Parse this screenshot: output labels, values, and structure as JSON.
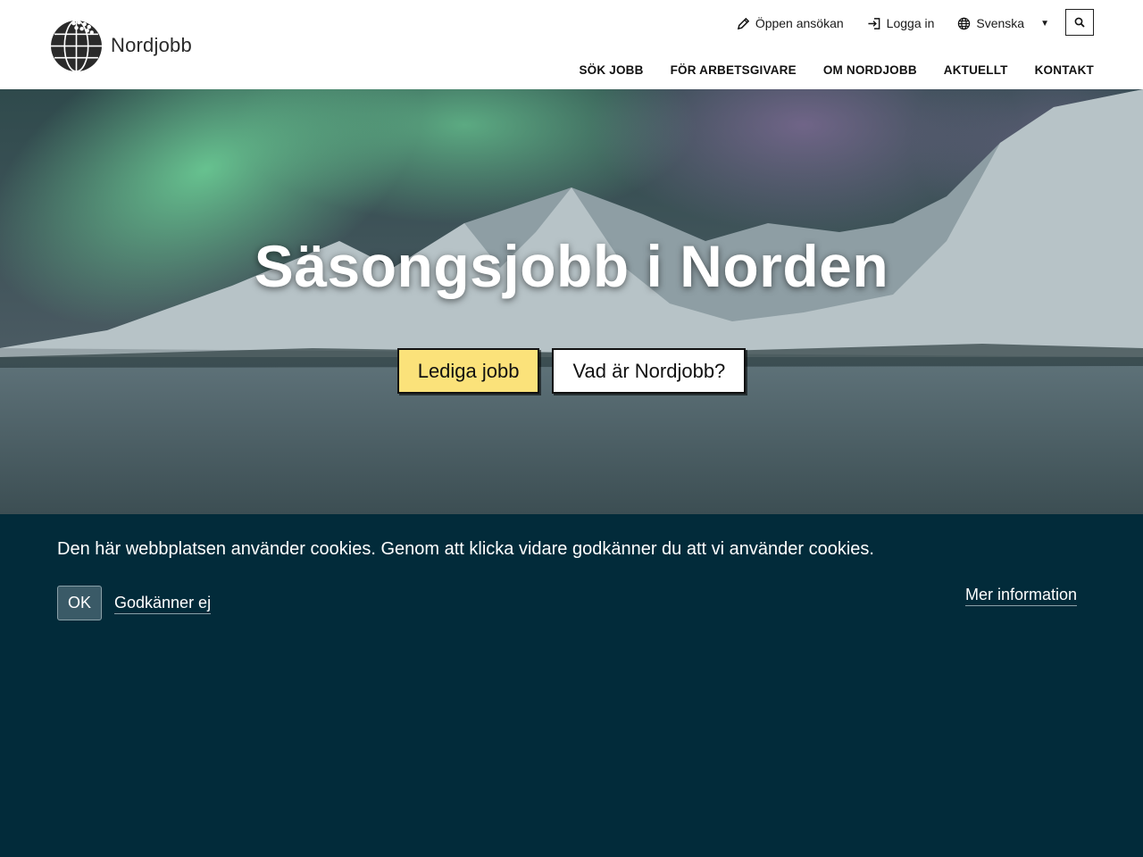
{
  "header": {
    "logo_text": "Nordjobb",
    "utility": {
      "open_application": "Öppen ansökan",
      "login": "Logga in",
      "language": "Svenska"
    },
    "nav": [
      {
        "label": "SÖK JOBB"
      },
      {
        "label": "FÖR ARBETSGIVARE"
      },
      {
        "label": "OM NORDJOBB"
      },
      {
        "label": "AKTUELLT"
      },
      {
        "label": "KONTAKT"
      }
    ]
  },
  "hero": {
    "title": "Säsongsjobb i Norden",
    "primary_button": "Lediga jobb",
    "secondary_button": "Vad är Nordjobb?"
  },
  "cookie_banner": {
    "text": "Den här webbplatsen använder cookies. Genom att klicka vidare godkänner du att vi använder cookies.",
    "ok": "OK",
    "decline": "Godkänner ej",
    "more_info": "Mer information"
  },
  "colors": {
    "header_bg": "#ffffff",
    "primary_button": "#fbe27a",
    "cookie_bg": "#022b3a"
  },
  "icons": [
    "globe-logo-icon",
    "pencil-icon",
    "login-icon",
    "globe-icon",
    "caret-down-icon",
    "search-icon"
  ]
}
